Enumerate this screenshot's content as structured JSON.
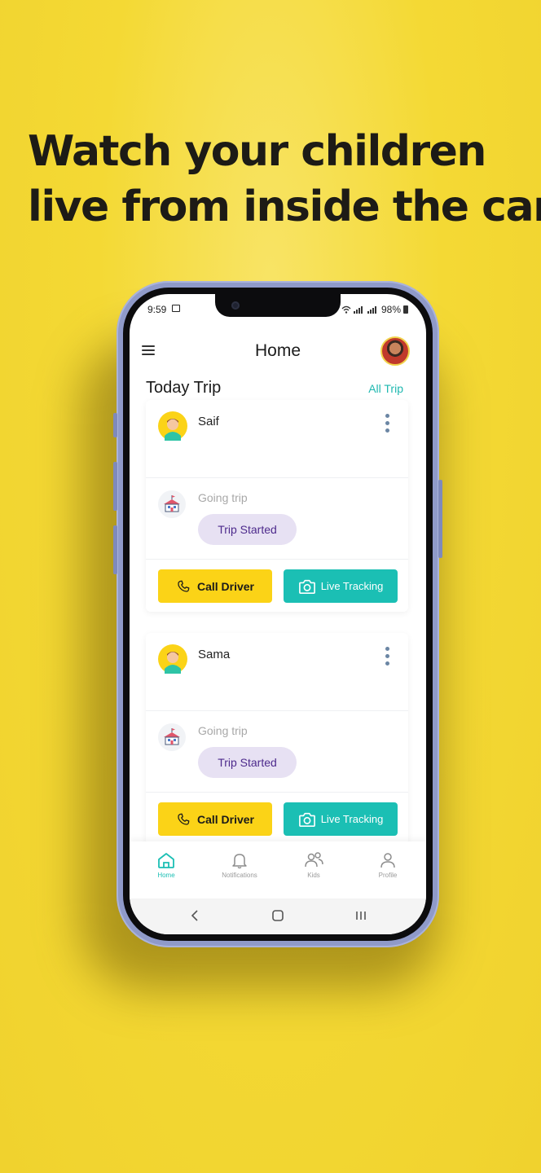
{
  "headline": {
    "line1": "Watch your children",
    "line2": "live from inside the car"
  },
  "status_bar": {
    "time": "9:59",
    "battery": "98%"
  },
  "header": {
    "title": "Home",
    "menu_icon": "hamburger-icon",
    "avatar_icon": "profile-avatar"
  },
  "section": {
    "title": "Today Trip",
    "link": "All Trip"
  },
  "trips": [
    {
      "kid_name": "Saif",
      "trip_type": "Going trip",
      "status": "Trip Started",
      "call_label": "Call Driver",
      "track_label": "Live Tracking"
    },
    {
      "kid_name": "Sama",
      "trip_type": "Going trip",
      "status": "Trip Started",
      "call_label": "Call Driver",
      "track_label": "Live Tracking"
    }
  ],
  "bottom_nav": [
    {
      "label": "Home",
      "icon": "home-icon",
      "active": true
    },
    {
      "label": "Notifications",
      "icon": "bell-icon",
      "active": false
    },
    {
      "label": "Kids",
      "icon": "users-icon",
      "active": false
    },
    {
      "label": "Profile",
      "icon": "person-icon",
      "active": false
    }
  ],
  "colors": {
    "background": "#f4d934",
    "accent_yellow": "#fbd317",
    "accent_teal": "#1bbfb4",
    "badge_bg": "#e7e1f3",
    "badge_text": "#4d2a8c"
  }
}
